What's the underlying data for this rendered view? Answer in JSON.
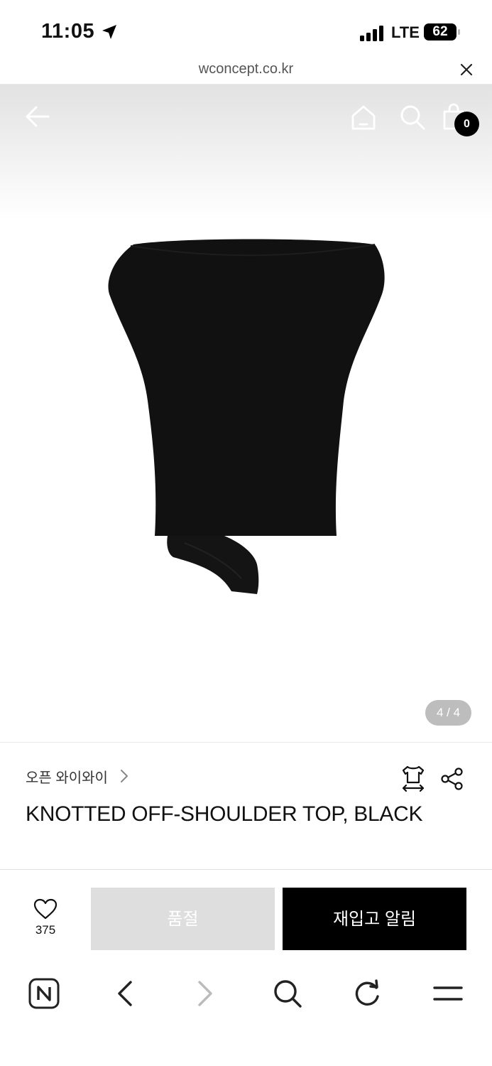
{
  "status_bar": {
    "time": "11:05",
    "network": "LTE",
    "battery": "62"
  },
  "browser": {
    "url": "wconcept.co.kr"
  },
  "header": {
    "cart_count": "0"
  },
  "gallery": {
    "pager": "4 / 4"
  },
  "product": {
    "brand": "오픈 와이와이",
    "title": "KNOTTED OFF-SHOULDER TOP, BLACK"
  },
  "actions": {
    "like_count": "375",
    "sold_out_label": "품절",
    "restock_label": "재입고 알림"
  },
  "icons": [
    "location-arrow-icon",
    "signal-icon",
    "close-icon",
    "back-arrow-icon",
    "home-icon",
    "search-icon",
    "cart-icon",
    "chevron-right-icon",
    "size-guide-icon",
    "share-icon",
    "heart-icon",
    "naver-icon",
    "browser-back-icon",
    "browser-forward-icon",
    "browser-search-icon",
    "reload-icon",
    "menu-icon"
  ],
  "colors": {
    "primary": "#000000",
    "disabled": "#dedede",
    "pager_bg": "#bdbdbd"
  }
}
